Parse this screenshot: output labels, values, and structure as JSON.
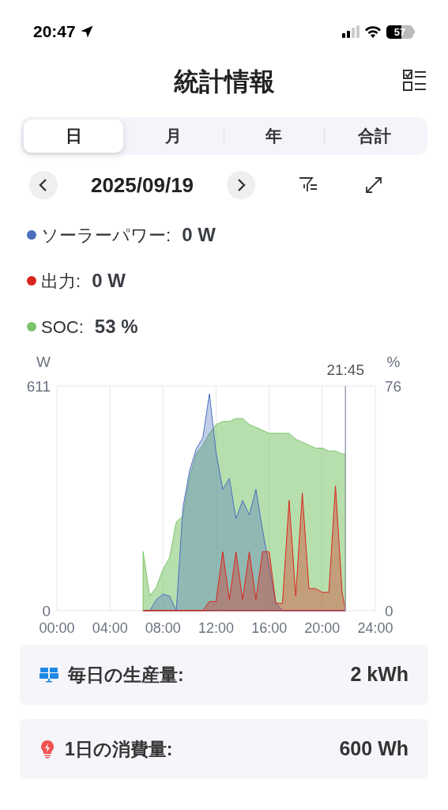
{
  "status_bar": {
    "time": "20:47",
    "battery": "57"
  },
  "header": {
    "title": "統計情報"
  },
  "tabs": [
    {
      "label": "日",
      "selected": true
    },
    {
      "label": "月",
      "selected": false
    },
    {
      "label": "年",
      "selected": false
    },
    {
      "label": "合計",
      "selected": false
    }
  ],
  "date_nav": {
    "date": "2025/09/19"
  },
  "legend": [
    {
      "label": "ソーラーパワー:",
      "value": "0 W",
      "color": "#4a6fc0"
    },
    {
      "label": "出力:",
      "value": "0 W",
      "color": "#d9261c"
    },
    {
      "label": "SOC:",
      "value": "53 %",
      "color": "#7cc46a"
    }
  ],
  "chart": {
    "chart_data": {
      "type": "area",
      "ylabel": "W",
      "y2label": "%",
      "xlim": [
        0,
        24
      ],
      "ylim": [
        0,
        611
      ],
      "y2lim": [
        0,
        76
      ],
      "xticks": [
        {
          "value": 0,
          "label": "00:00"
        },
        {
          "value": 4,
          "label": "04:00"
        },
        {
          "value": 8,
          "label": "08:00"
        },
        {
          "value": 12,
          "label": "12:00"
        },
        {
          "value": 16,
          "label": "16:00"
        },
        {
          "value": 20,
          "label": "20:00"
        },
        {
          "value": 24,
          "label": "24:00"
        }
      ],
      "yticks": [
        0,
        611
      ],
      "grid": true,
      "y2ticks": [
        0,
        76
      ],
      "annotations": [
        {
          "x": 21.75,
          "text": "21:45"
        }
      ],
      "x": [
        6.5,
        7,
        7.5,
        8,
        8.5,
        9,
        9.5,
        10,
        10.5,
        11,
        11.5,
        12,
        12.5,
        13,
        13.5,
        14,
        14.5,
        15,
        15.5,
        16,
        16.5,
        17,
        17.5,
        18,
        18.5,
        19,
        19.5,
        20,
        20.5,
        21,
        21.5,
        21.75
      ],
      "series": [
        {
          "color": "#7cc46a",
          "axis": "y2",
          "values": [
            20,
            5,
            8,
            14,
            18,
            30,
            32,
            45,
            53,
            56,
            60,
            63,
            64,
            64,
            65,
            65,
            63,
            62,
            61,
            60,
            60,
            60,
            60,
            58,
            57,
            56,
            55,
            55,
            54,
            54,
            53,
            53
          ]
        },
        {
          "color": "#4a6fc0",
          "values": [
            0,
            0,
            30,
            45,
            40,
            0,
            280,
            380,
            440,
            470,
            590,
            430,
            330,
            360,
            250,
            300,
            260,
            330,
            220,
            120,
            20,
            0,
            0,
            0,
            0,
            0,
            0,
            0,
            0,
            0,
            0,
            0
          ]
        },
        {
          "color": "#d9261c",
          "values": [
            0,
            0,
            0,
            0,
            0,
            0,
            0,
            0,
            0,
            0,
            25,
            25,
            160,
            30,
            160,
            30,
            160,
            30,
            160,
            160,
            20,
            20,
            300,
            40,
            320,
            60,
            60,
            50,
            50,
            340,
            50,
            0
          ]
        }
      ]
    }
  },
  "summary": [
    {
      "kind": "production",
      "label": "毎日の生産量:",
      "value": "2 kWh"
    },
    {
      "kind": "consumption",
      "label": "1日の消費量:",
      "value": "600 Wh"
    }
  ]
}
